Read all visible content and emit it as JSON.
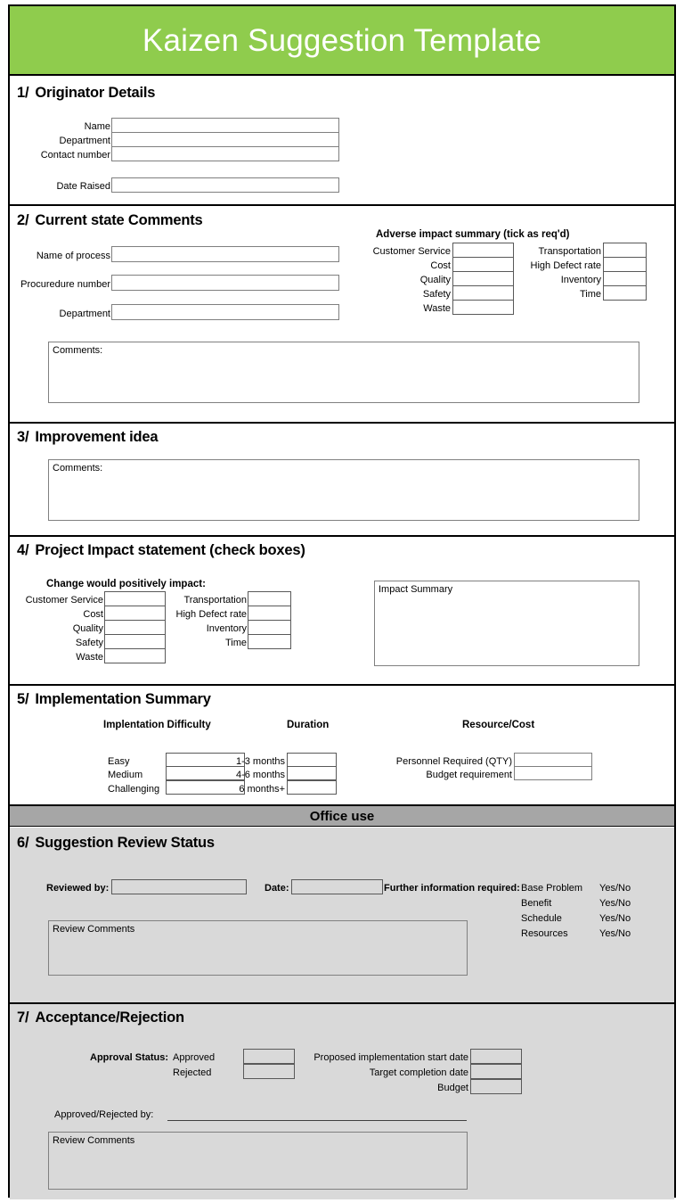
{
  "document": {
    "title": "Kaizen Suggestion Template",
    "banner_color": "#8fcc4d",
    "office_strip_color": "#a6a6a6",
    "office_section_color": "#d9d9d9"
  },
  "section1": {
    "number": "1/",
    "heading": "Originator Details",
    "fields": [
      {
        "label": "Name",
        "value": ""
      },
      {
        "label": "Department",
        "value": ""
      },
      {
        "label": "Contact number",
        "value": ""
      }
    ],
    "date_field": {
      "label": "Date Raised",
      "value": ""
    }
  },
  "section2": {
    "number": "2/",
    "heading": "Current state Comments",
    "fields": [
      {
        "label": "Name of process",
        "value": ""
      },
      {
        "label": "Procuredure number",
        "value": ""
      },
      {
        "label": "Department",
        "value": ""
      }
    ],
    "impact_title": "Adverse impact summary (tick as req'd)",
    "impact_left": [
      "Customer Service",
      "Cost",
      "Quality",
      "Safety",
      "Waste"
    ],
    "impact_right": [
      "Transportation",
      "High Defect rate",
      "Inventory",
      "Time"
    ],
    "comments_placeholder": "Comments:",
    "comments_value": ""
  },
  "section3": {
    "number": "3/",
    "heading": "Improvement idea",
    "comments_placeholder": "Comments:",
    "comments_value": ""
  },
  "section4": {
    "number": "4/",
    "heading": "Project Impact statement (check boxes)",
    "impact_title": "Change would positively impact:",
    "impact_left": [
      "Customer Service",
      "Cost",
      "Quality",
      "Safety",
      "Waste"
    ],
    "impact_right": [
      "Transportation",
      "High Defect rate",
      "Inventory",
      "Time"
    ],
    "summary_placeholder": "Impact Summary",
    "summary_value": ""
  },
  "section5": {
    "number": "5/",
    "heading": "Implementation Summary",
    "col1_header": "Implentation Difficulty",
    "col1_rows": [
      "Easy",
      "Medium",
      "Challenging"
    ],
    "col2_header": "Duration",
    "col2_rows": [
      "1-3 months",
      "4-6 months",
      "6 months+"
    ],
    "col3_header": "Resource/Cost",
    "col3_rows": [
      "Personnel Required (QTY)",
      "Budget requirement"
    ]
  },
  "office_strip": {
    "label": "Office use"
  },
  "section6": {
    "number": "6/",
    "heading": "Suggestion Review Status",
    "reviewed_by_label": "Reviewed by:",
    "reviewed_by_value": "",
    "date_label": "Date:",
    "date_value": "",
    "further_info_label": "Further information required:",
    "further_info_rows": [
      {
        "item": "Base Problem",
        "answer": "Yes/No"
      },
      {
        "item": "Benefit",
        "answer": "Yes/No"
      },
      {
        "item": "Schedule",
        "answer": "Yes/No"
      },
      {
        "item": "Resources",
        "answer": "Yes/No"
      }
    ],
    "comments_placeholder": "Review Comments",
    "comments_value": ""
  },
  "section7": {
    "number": "7/",
    "heading": "Acceptance/Rejection",
    "approval_status_label": "Approval Status:",
    "approval_options": [
      "Approved",
      "Rejected"
    ],
    "date_rows": [
      "Proposed implementation start date",
      "Target completion date",
      "Budget"
    ],
    "approved_by_label": "Approved/Rejected by:",
    "approved_by_value": "",
    "comments_placeholder": "Review Comments",
    "comments_value": ""
  }
}
